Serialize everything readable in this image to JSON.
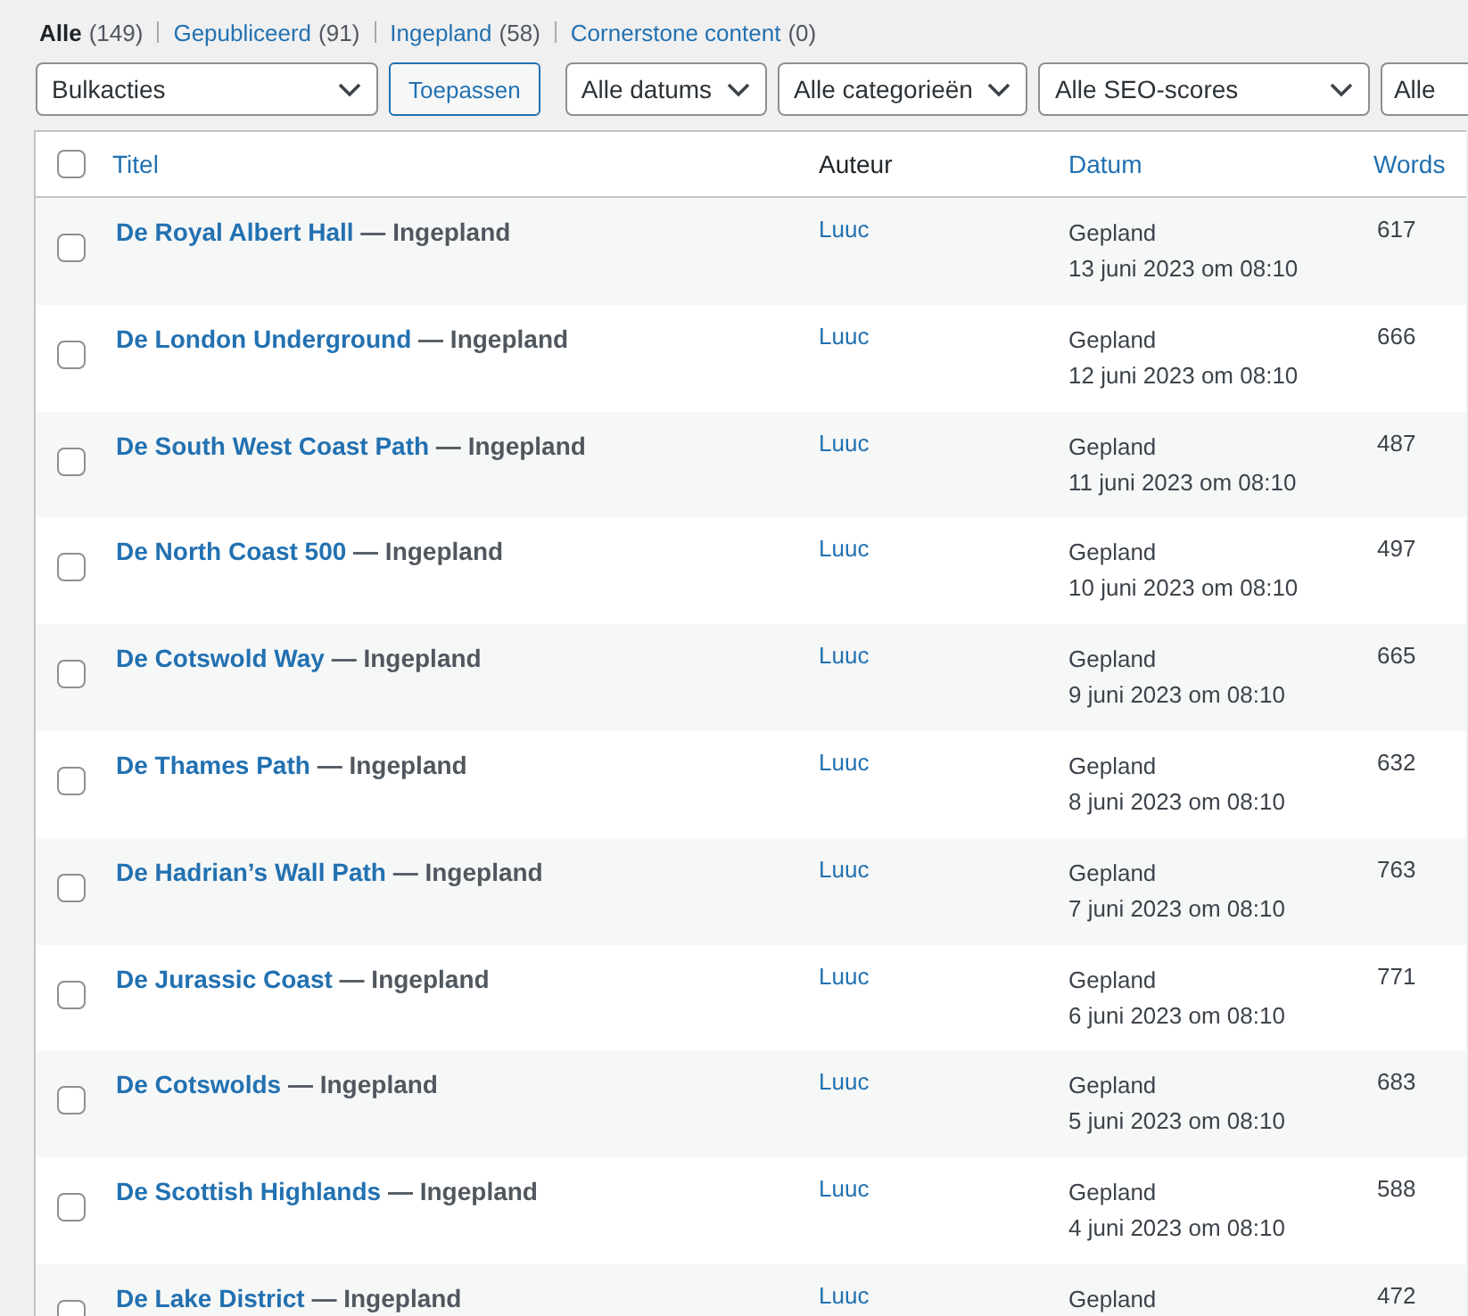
{
  "status_links": [
    {
      "label": "Alle",
      "count": "(149)",
      "selected": true
    },
    {
      "label": "Gepubliceerd",
      "count": "(91)",
      "selected": false
    },
    {
      "label": "Ingepland",
      "count": "(58)",
      "selected": false
    },
    {
      "label": "Cornerstone content",
      "count": "(0)",
      "selected": false
    }
  ],
  "bulk_actions": {
    "value": "Bulkacties"
  },
  "apply_button": "Toepassen",
  "filters": [
    {
      "value": "Alle datums",
      "kind": "compact"
    },
    {
      "value": "Alle categorieën",
      "kind": "compact"
    },
    {
      "value": "Alle SEO-scores",
      "kind": "wide"
    },
    {
      "value": "Alle",
      "kind": "cut"
    }
  ],
  "table": {
    "select_all": {
      "checked": false
    },
    "columns": [
      {
        "label": "Titel",
        "sortable": true
      },
      {
        "label": "Auteur",
        "sortable": false
      },
      {
        "label": "Datum",
        "sortable": true
      },
      {
        "label": "Words",
        "sortable": true
      }
    ],
    "rows": [
      {
        "checked": false,
        "title": "De Royal Albert Hall",
        "state": "— Ingepland",
        "author": "Luuc",
        "status": "Gepland",
        "date": "13 juni 2023 om 08:10",
        "words": "617"
      },
      {
        "checked": false,
        "title": "De London Underground",
        "state": "— Ingepland",
        "author": "Luuc",
        "status": "Gepland",
        "date": "12 juni 2023 om 08:10",
        "words": "666"
      },
      {
        "checked": false,
        "title": "De South West Coast Path",
        "state": "— Ingepland",
        "author": "Luuc",
        "status": "Gepland",
        "date": "11 juni 2023 om 08:10",
        "words": "487"
      },
      {
        "checked": false,
        "title": "De North Coast 500",
        "state": "— Ingepland",
        "author": "Luuc",
        "status": "Gepland",
        "date": "10 juni 2023 om 08:10",
        "words": "497"
      },
      {
        "checked": false,
        "title": "De Cotswold Way",
        "state": "— Ingepland",
        "author": "Luuc",
        "status": "Gepland",
        "date": "9 juni 2023 om 08:10",
        "words": "665"
      },
      {
        "checked": false,
        "title": "De Thames Path",
        "state": "— Ingepland",
        "author": "Luuc",
        "status": "Gepland",
        "date": "8 juni 2023 om 08:10",
        "words": "632"
      },
      {
        "checked": false,
        "title": "De Hadrian’s Wall Path",
        "state": "— Ingepland",
        "author": "Luuc",
        "status": "Gepland",
        "date": "7 juni 2023 om 08:10",
        "words": "763"
      },
      {
        "checked": false,
        "title": "De Jurassic Coast",
        "state": "— Ingepland",
        "author": "Luuc",
        "status": "Gepland",
        "date": "6 juni 2023 om 08:10",
        "words": "771"
      },
      {
        "checked": false,
        "title": "De Cotswolds",
        "state": "— Ingepland",
        "author": "Luuc",
        "status": "Gepland",
        "date": "5 juni 2023 om 08:10",
        "words": "683"
      },
      {
        "checked": false,
        "title": "De Scottish Highlands",
        "state": "— Ingepland",
        "author": "Luuc",
        "status": "Gepland",
        "date": "4 juni 2023 om 08:10",
        "words": "588"
      },
      {
        "checked": false,
        "title": "De Lake District",
        "state": "— Ingepland",
        "author": "Luuc",
        "status": "Gepland",
        "words": "472"
      }
    ]
  }
}
